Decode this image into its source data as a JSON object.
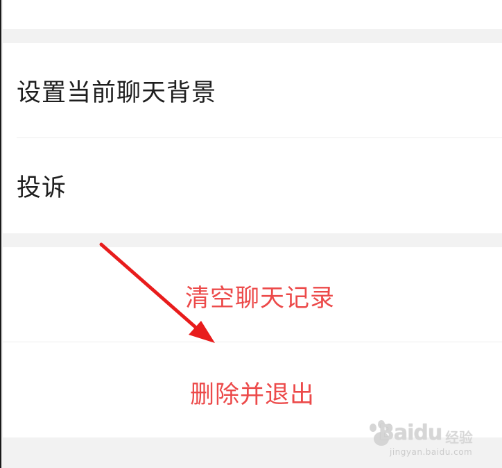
{
  "settings": {
    "group1": [
      {
        "label": "设置当前聊天背景"
      },
      {
        "label": "投诉"
      }
    ],
    "group2": [
      {
        "label": "清空聊天记录"
      },
      {
        "label": "删除并退出"
      }
    ]
  },
  "colors": {
    "background": "#f2f2f2",
    "card": "#ffffff",
    "danger": "#ec4a4a",
    "annotation_arrow": "#e81c1c"
  },
  "watermark": {
    "brand": "Bai",
    "brand_tail": "du",
    "sub": "经验",
    "url": "jingyan.baidu.com"
  }
}
